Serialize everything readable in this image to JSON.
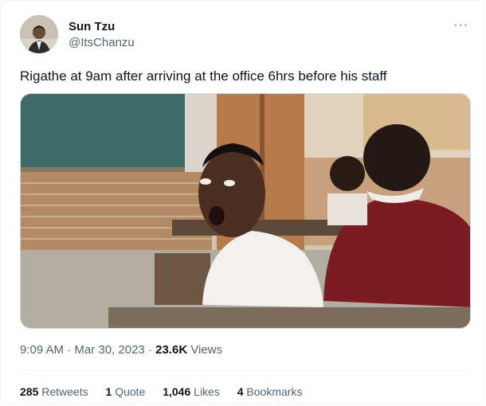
{
  "author": {
    "name": "Sun Tzu",
    "handle": "@ItsChanzu"
  },
  "menu": {
    "more_icon": "ellipsis-icon",
    "more_label": "···"
  },
  "tweet": {
    "text": "Rigathe at 9am after arriving at the office 6hrs before his staff",
    "media_icon": "photo-classroom-students"
  },
  "meta": {
    "time": "9:09 AM",
    "separator": "·",
    "date": "Mar 30, 2023",
    "views_count": "23.6K",
    "views_label": "Views"
  },
  "stats": {
    "retweets_count": "285",
    "retweets_label": "Retweets",
    "quotes_count": "1",
    "quotes_label": "Quote",
    "likes_count": "1,046",
    "likes_label": "Likes",
    "bookmarks_count": "4",
    "bookmarks_label": "Bookmarks"
  }
}
